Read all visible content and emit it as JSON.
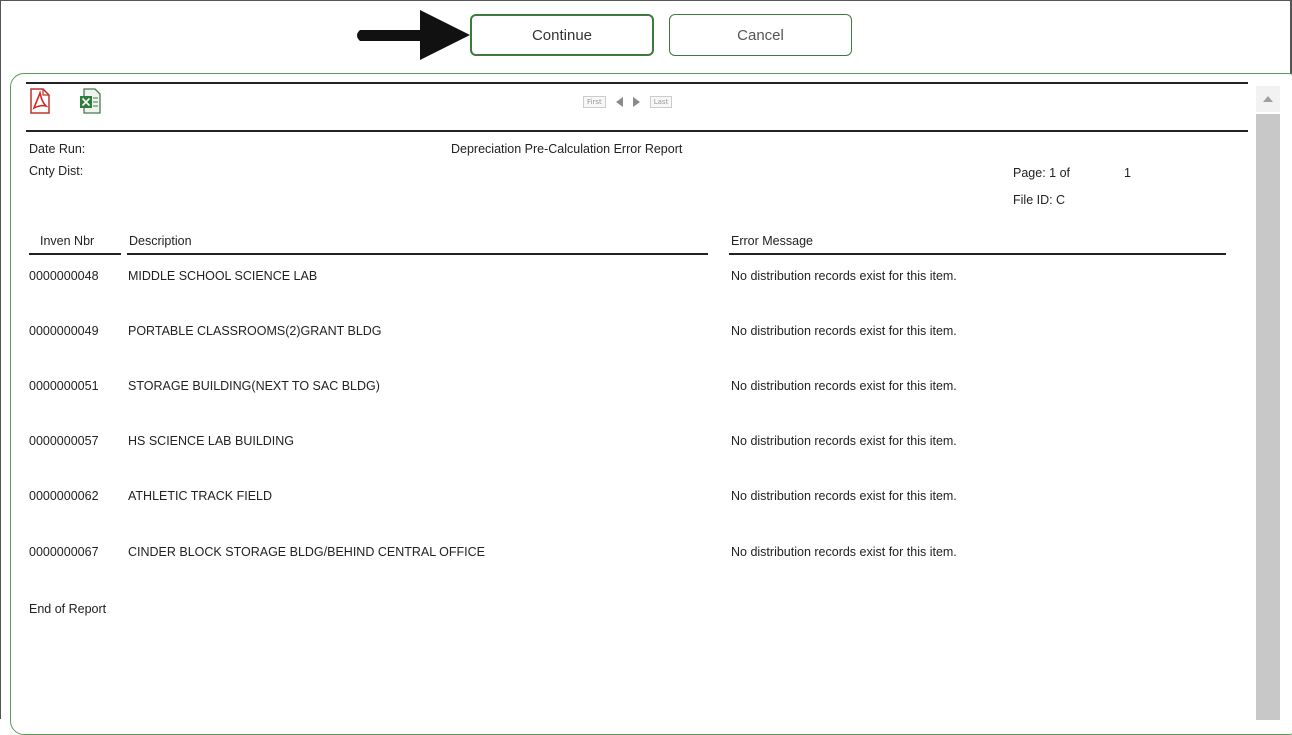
{
  "buttons": {
    "continue": "Continue",
    "cancel": "Cancel"
  },
  "toolbar": {
    "icons": [
      "pdf-export-icon",
      "excel-export-icon"
    ],
    "pager": {
      "first": "First",
      "last": "Last"
    }
  },
  "report": {
    "date_run_label": "Date Run:",
    "title": "Depreciation Pre-Calculation Error Report",
    "cnty_dist_label": "Cnty Dist:",
    "page_label": "Page: 1 of",
    "page_total": "1",
    "file_id": "File ID: C",
    "columns": {
      "inven_nbr": "Inven Nbr",
      "description": "Description",
      "error_message": "Error Message"
    },
    "rows": [
      {
        "inven_nbr": "0000000048",
        "description": "MIDDLE SCHOOL SCIENCE LAB",
        "error": "No distribution records exist for this item."
      },
      {
        "inven_nbr": "0000000049",
        "description": "PORTABLE CLASSROOMS(2)GRANT BLDG",
        "error": "No distribution records exist for this item."
      },
      {
        "inven_nbr": "0000000051",
        "description": "STORAGE BUILDING(NEXT TO SAC BLDG)",
        "error": "No distribution records exist for this item."
      },
      {
        "inven_nbr": "0000000057",
        "description": "HS SCIENCE LAB BUILDING",
        "error": "No distribution records exist for this item."
      },
      {
        "inven_nbr": "0000000062",
        "description": "ATHLETIC TRACK FIELD",
        "error": "No distribution records exist for this item."
      },
      {
        "inven_nbr": "0000000067",
        "description": "CINDER BLOCK STORAGE BLDG/BEHIND CENTRAL OFFICE",
        "error": "No distribution records exist for this item."
      }
    ],
    "end_label": "End of Report"
  },
  "colors": {
    "button_border": "#3d7a3d",
    "panel_border": "#5a9a5a",
    "scrollbar": "#c8c8c8"
  }
}
